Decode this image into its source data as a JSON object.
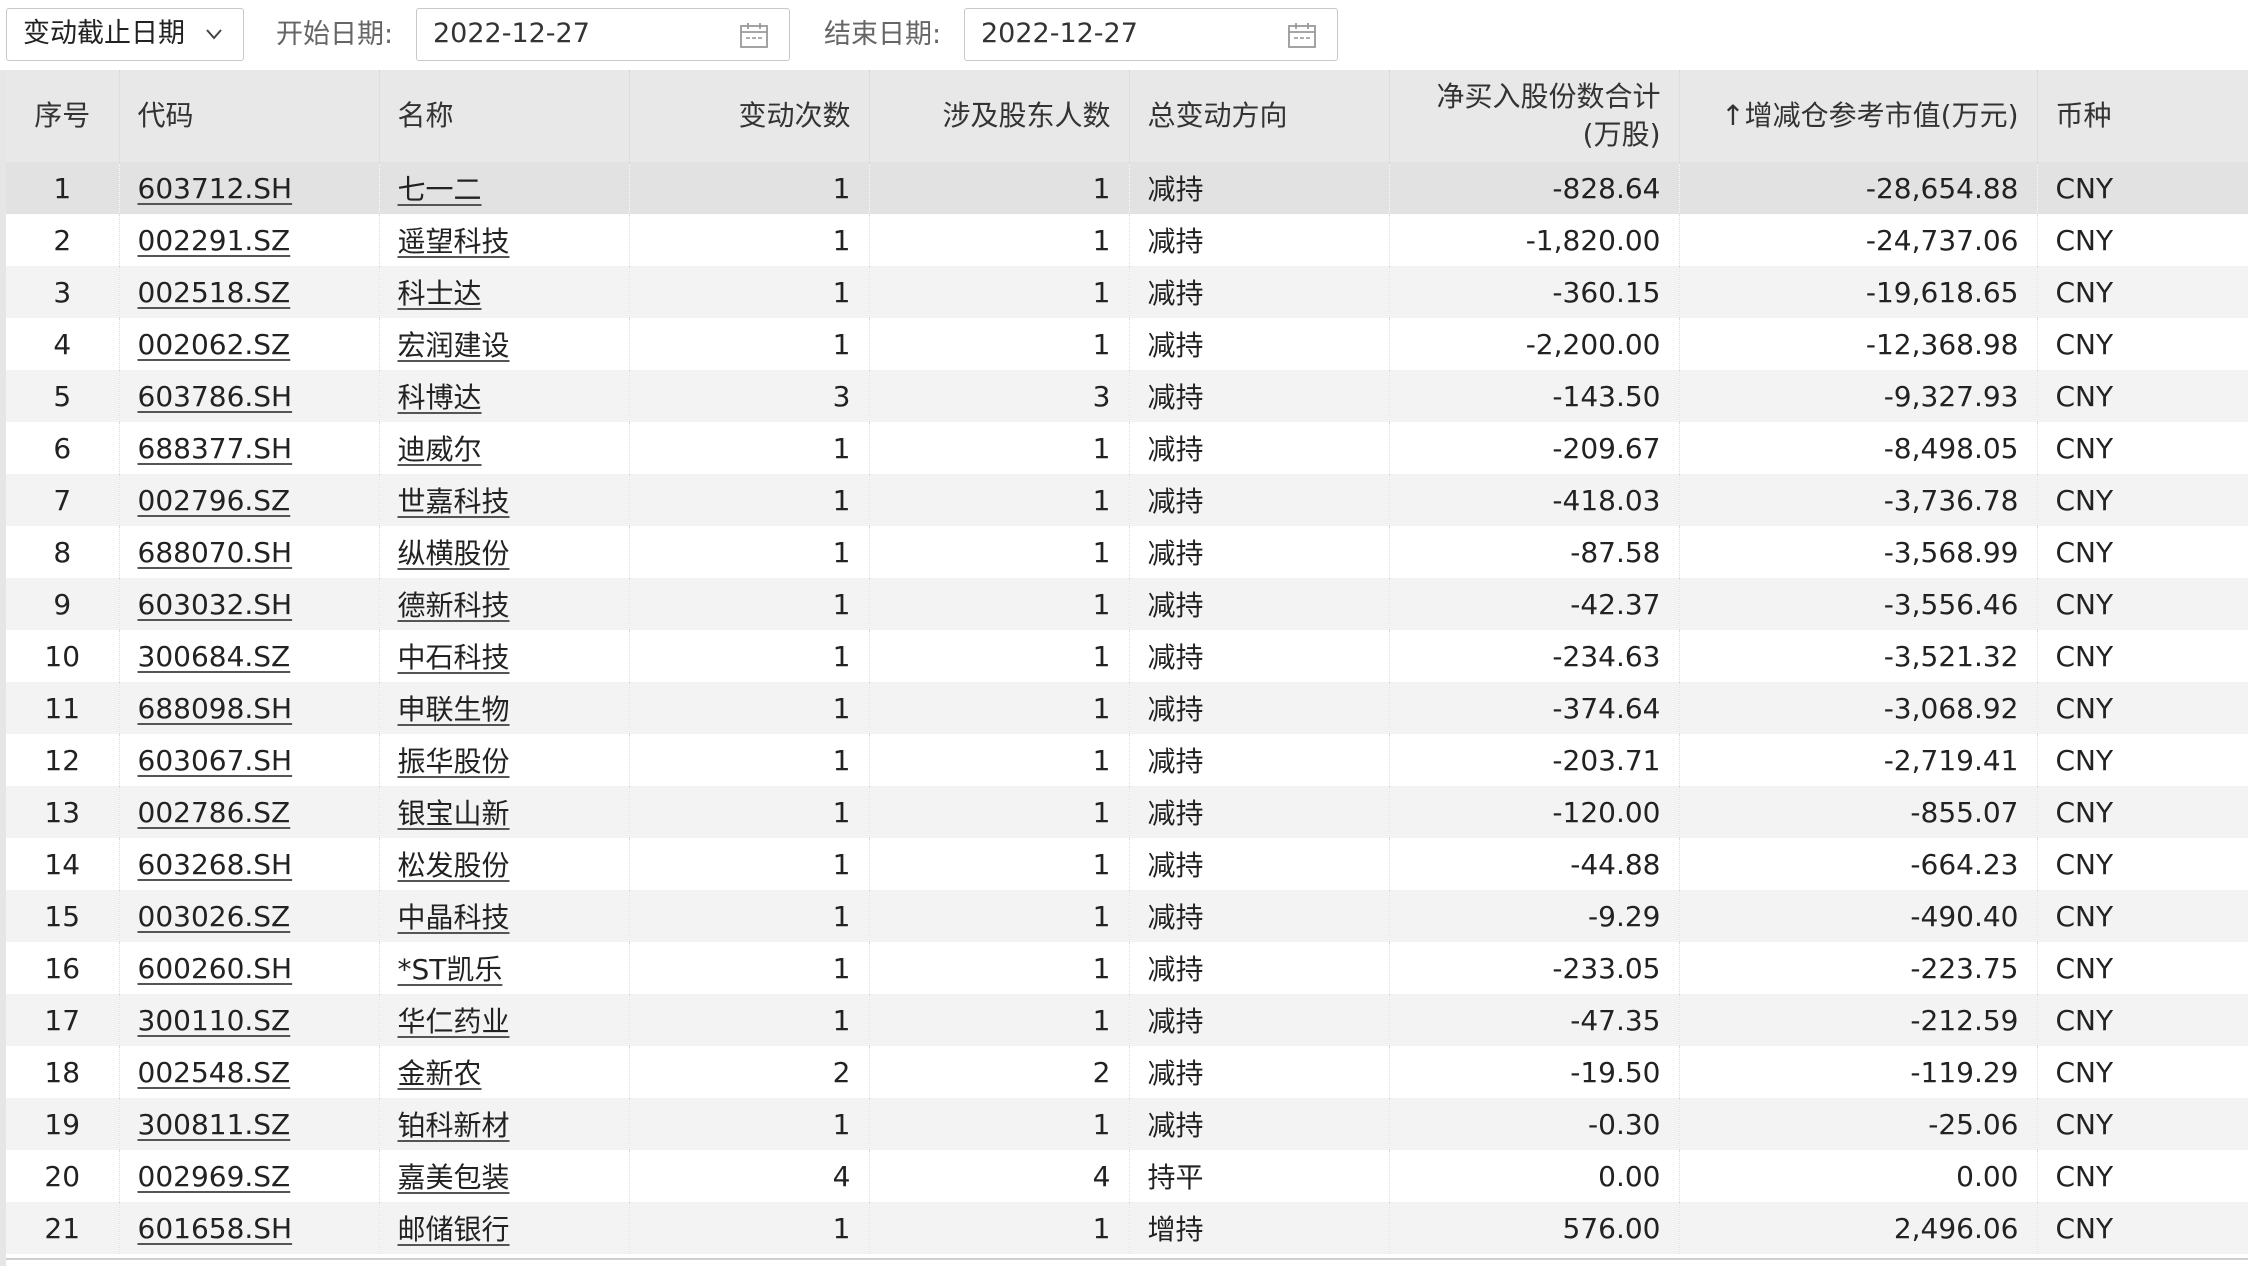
{
  "filters": {
    "dropdown_label": "变动截止日期",
    "start_label": "开始日期:",
    "start_value": "2022-12-27",
    "end_label": "结束日期:",
    "end_value": "2022-12-27"
  },
  "table": {
    "headers": [
      "序号",
      "代码",
      "名称",
      "变动次数",
      "涉及股东人数",
      "总变动方向",
      "净买入股份数合计\n(万股)",
      "↑增减仓参考市值(万元)",
      "币种"
    ],
    "rows": [
      [
        "1",
        "603712.SH",
        "七一二",
        "1",
        "1",
        "减持",
        "-828.64",
        "-28,654.88",
        "CNY"
      ],
      [
        "2",
        "002291.SZ",
        "遥望科技",
        "1",
        "1",
        "减持",
        "-1,820.00",
        "-24,737.06",
        "CNY"
      ],
      [
        "3",
        "002518.SZ",
        "科士达",
        "1",
        "1",
        "减持",
        "-360.15",
        "-19,618.65",
        "CNY"
      ],
      [
        "4",
        "002062.SZ",
        "宏润建设",
        "1",
        "1",
        "减持",
        "-2,200.00",
        "-12,368.98",
        "CNY"
      ],
      [
        "5",
        "603786.SH",
        "科博达",
        "3",
        "3",
        "减持",
        "-143.50",
        "-9,327.93",
        "CNY"
      ],
      [
        "6",
        "688377.SH",
        "迪威尔",
        "1",
        "1",
        "减持",
        "-209.67",
        "-8,498.05",
        "CNY"
      ],
      [
        "7",
        "002796.SZ",
        "世嘉科技",
        "1",
        "1",
        "减持",
        "-418.03",
        "-3,736.78",
        "CNY"
      ],
      [
        "8",
        "688070.SH",
        "纵横股份",
        "1",
        "1",
        "减持",
        "-87.58",
        "-3,568.99",
        "CNY"
      ],
      [
        "9",
        "603032.SH",
        "德新科技",
        "1",
        "1",
        "减持",
        "-42.37",
        "-3,556.46",
        "CNY"
      ],
      [
        "10",
        "300684.SZ",
        "中石科技",
        "1",
        "1",
        "减持",
        "-234.63",
        "-3,521.32",
        "CNY"
      ],
      [
        "11",
        "688098.SH",
        "申联生物",
        "1",
        "1",
        "减持",
        "-374.64",
        "-3,068.92",
        "CNY"
      ],
      [
        "12",
        "603067.SH",
        "振华股份",
        "1",
        "1",
        "减持",
        "-203.71",
        "-2,719.41",
        "CNY"
      ],
      [
        "13",
        "002786.SZ",
        "银宝山新",
        "1",
        "1",
        "减持",
        "-120.00",
        "-855.07",
        "CNY"
      ],
      [
        "14",
        "603268.SH",
        "松发股份",
        "1",
        "1",
        "减持",
        "-44.88",
        "-664.23",
        "CNY"
      ],
      [
        "15",
        "003026.SZ",
        "中晶科技",
        "1",
        "1",
        "减持",
        "-9.29",
        "-490.40",
        "CNY"
      ],
      [
        "16",
        "600260.SH",
        "*ST凯乐",
        "1",
        "1",
        "减持",
        "-233.05",
        "-223.75",
        "CNY"
      ],
      [
        "17",
        "300110.SZ",
        "华仁药业",
        "1",
        "1",
        "减持",
        "-47.35",
        "-212.59",
        "CNY"
      ],
      [
        "18",
        "002548.SZ",
        "金新农",
        "2",
        "2",
        "减持",
        "-19.50",
        "-119.29",
        "CNY"
      ],
      [
        "19",
        "300811.SZ",
        "铂科新材",
        "1",
        "1",
        "减持",
        "-0.30",
        "-25.06",
        "CNY"
      ],
      [
        "20",
        "002969.SZ",
        "嘉美包装",
        "4",
        "4",
        "持平",
        "0.00",
        "0.00",
        "CNY"
      ],
      [
        "21",
        "601658.SH",
        "邮储银行",
        "1",
        "1",
        "增持",
        "576.00",
        "2,496.06",
        "CNY"
      ]
    ]
  }
}
